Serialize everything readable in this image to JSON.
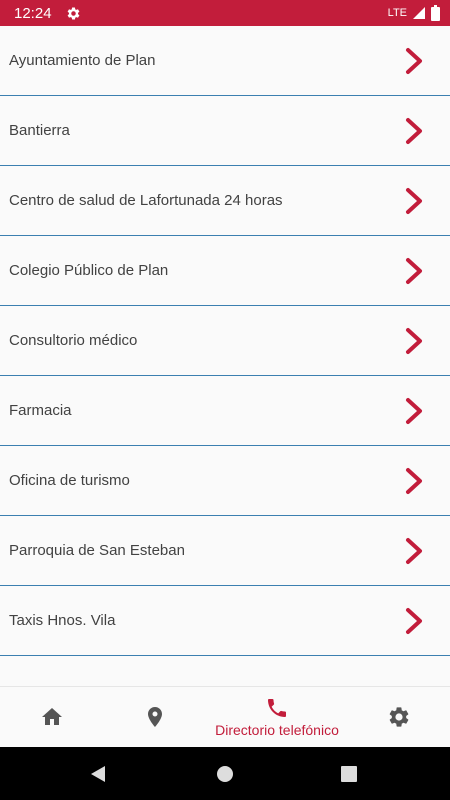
{
  "status_bar": {
    "time": "12:24",
    "network": "LTE",
    "background_color": "#c21d3b",
    "icons": [
      "settings-icon",
      "signal-icon",
      "battery-icon"
    ]
  },
  "directory": {
    "items": [
      {
        "label": "Ayuntamiento de Plan"
      },
      {
        "label": "Bantierra"
      },
      {
        "label": "Centro de salud de Lafortunada 24 horas"
      },
      {
        "label": "Colegio Público de Plan"
      },
      {
        "label": "Consultorio médico"
      },
      {
        "label": "Farmacia"
      },
      {
        "label": "Oficina de turismo"
      },
      {
        "label": "Parroquia de San Esteban"
      },
      {
        "label": "Taxis Hnos. Vila"
      }
    ],
    "row_icon": "chevron-right-icon",
    "divider_color": "#3b7fb0",
    "chevron_color": "#c21d3b"
  },
  "bottom_nav": {
    "items": [
      {
        "icon": "home-icon",
        "label": "",
        "active": false
      },
      {
        "icon": "location-pin-icon",
        "label": "",
        "active": false
      },
      {
        "icon": "phone-icon",
        "label": "Directorio telefónico",
        "active": true
      },
      {
        "icon": "gear-icon",
        "label": "",
        "active": false
      }
    ],
    "active_color": "#c21d3b",
    "inactive_color": "#555555"
  },
  "system_nav": {
    "buttons": [
      "back-icon",
      "home-circle-icon",
      "recents-icon"
    ]
  }
}
